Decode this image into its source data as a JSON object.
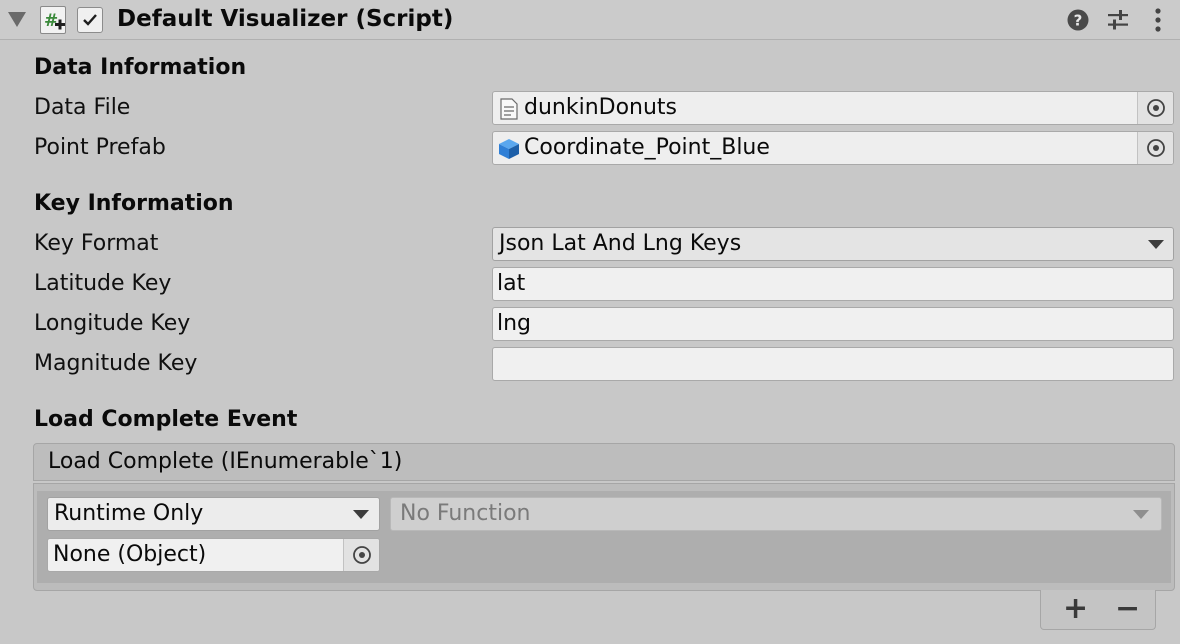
{
  "header": {
    "title": "Default Visualizer (Script)",
    "enabled": true
  },
  "data_information": {
    "heading": "Data Information",
    "data_file": {
      "label": "Data File",
      "value": "dunkinDonuts",
      "icon": "text-asset-icon"
    },
    "point_prefab": {
      "label": "Point Prefab",
      "value": "Coordinate_Point_Blue",
      "icon": "prefab-cube-icon",
      "icon_color": "#2f7fd6"
    }
  },
  "key_information": {
    "heading": "Key Information",
    "key_format": {
      "label": "Key Format",
      "value": "Json Lat And Lng Keys"
    },
    "latitude_key": {
      "label": "Latitude Key",
      "value": "lat"
    },
    "longitude_key": {
      "label": "Longitude Key",
      "value": "lng"
    },
    "magnitude_key": {
      "label": "Magnitude Key",
      "value": ""
    }
  },
  "load_complete_event": {
    "heading": "Load Complete Event",
    "event_header": "Load Complete (IEnumerable`1)",
    "runtime_mode": "Runtime Only",
    "function": "No Function",
    "target_object": "None (Object)",
    "add_label": "+",
    "remove_label": "−"
  }
}
